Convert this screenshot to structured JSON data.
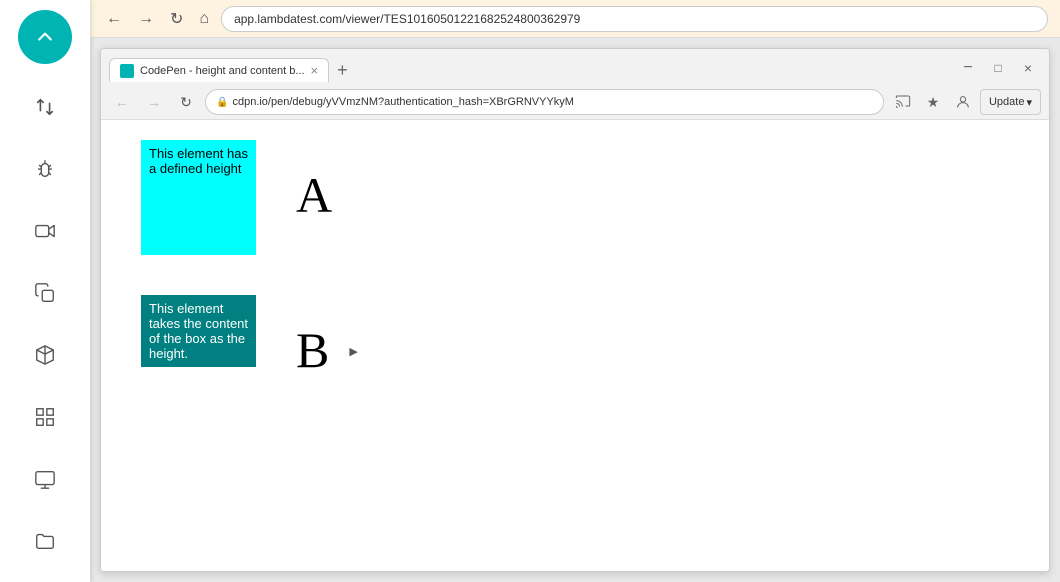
{
  "addressBar": {
    "url": "app.lambdatest.com/viewer/TES10160501221682524800362979"
  },
  "sidebar": {
    "topButton": "▲",
    "icons": [
      "swap-icon",
      "bug-icon",
      "video-icon",
      "copy-icon",
      "box-icon",
      "grid-icon",
      "screen-icon",
      "folder-icon"
    ]
  },
  "browser": {
    "tab": {
      "label": "CodePen - height and content b...",
      "url": "cdpn.io/pen/debug/yVVmzNM?authentication_hash=XBrGRNVYYkyM"
    },
    "updateButton": "Update",
    "content": {
      "boxAText": "This element has a defined height",
      "boxBText": "This element takes the content of the box as the height.",
      "letterA": "A",
      "letterB": "B"
    }
  }
}
